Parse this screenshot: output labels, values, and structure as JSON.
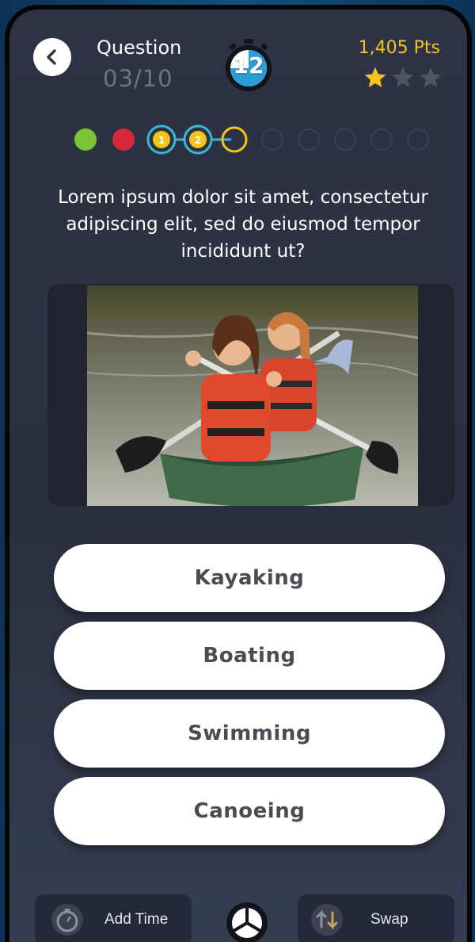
{
  "header": {
    "question_label": "Question",
    "question_count": "03/10",
    "timer_value": "12",
    "points": "1,405 Pts",
    "stars_filled": 1,
    "stars_total": 3
  },
  "progress": {
    "markers": [
      "",
      "",
      "1",
      "2",
      "",
      "",
      "",
      "",
      "",
      ""
    ],
    "colors": {
      "correct": "#7cc436",
      "wrong": "#d62a3a",
      "active": "#f2c51b",
      "ring": "#3bb6d6",
      "empty": "#3a4154"
    }
  },
  "question": {
    "text": "Lorem ipsum dolor sit amet, consectetur adipiscing elit, sed do eiusmod tempor incididunt ut?"
  },
  "image": {
    "description_icon": "canoe-photo"
  },
  "answers": [
    {
      "label": "Kayaking"
    },
    {
      "label": "Boating"
    },
    {
      "label": "Swimming"
    },
    {
      "label": "Canoeing"
    }
  ],
  "powerups": {
    "add_time_label": "Add Time",
    "swap_label": "Swap"
  }
}
